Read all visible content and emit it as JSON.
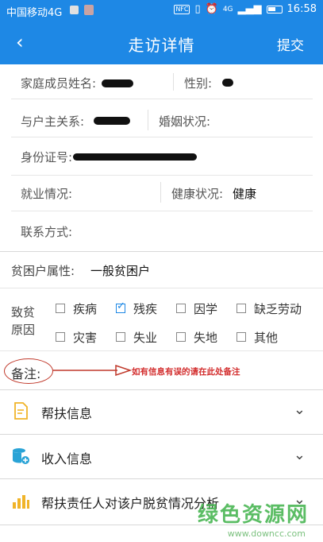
{
  "status_bar": {
    "carrier": "中国移动4G",
    "time": "16:58",
    "nfc": "NFC",
    "network": "4G"
  },
  "header": {
    "title": "走访详情",
    "back_icon": "chevron-left-icon",
    "submit_label": "提交"
  },
  "form": {
    "member_name_label": "家庭成员姓名:",
    "gender_label": "性别:",
    "relation_label": "与户主关系:",
    "marital_label": "婚姻状况:",
    "id_label": "身份证号:",
    "employment_label": "就业情况:",
    "health_label": "健康状况:",
    "health_value": "健康",
    "contact_label": "联系方式:",
    "poverty_attr_label": "贫困户属性:",
    "poverty_attr_value": "一般贫困户",
    "cause_label_line1": "致贫",
    "cause_label_line2": "原因",
    "causes": [
      {
        "label": "疾病",
        "checked": false
      },
      {
        "label": "残疾",
        "checked": true
      },
      {
        "label": "因学",
        "checked": false
      },
      {
        "label": "缺乏劳动",
        "checked": false
      },
      {
        "label": "灾害",
        "checked": false
      },
      {
        "label": "失业",
        "checked": false
      },
      {
        "label": "失地",
        "checked": false
      },
      {
        "label": "其他",
        "checked": false
      }
    ],
    "note_label": "备注:",
    "note_hint": "如有信息有误的请在此处备注"
  },
  "sections": [
    {
      "title": "帮扶信息",
      "icon": "document-icon"
    },
    {
      "title": "收入信息",
      "icon": "database-add-icon"
    },
    {
      "title": "帮扶责任人对该户脱贫情况分析",
      "icon": "bar-chart-icon"
    }
  ],
  "watermark": {
    "text": "绿色资源网",
    "url": "www.downcc.com"
  },
  "colors": {
    "primary": "#1e88e5",
    "annotation": "#d32f2f",
    "watermark": "#3fb24a"
  }
}
